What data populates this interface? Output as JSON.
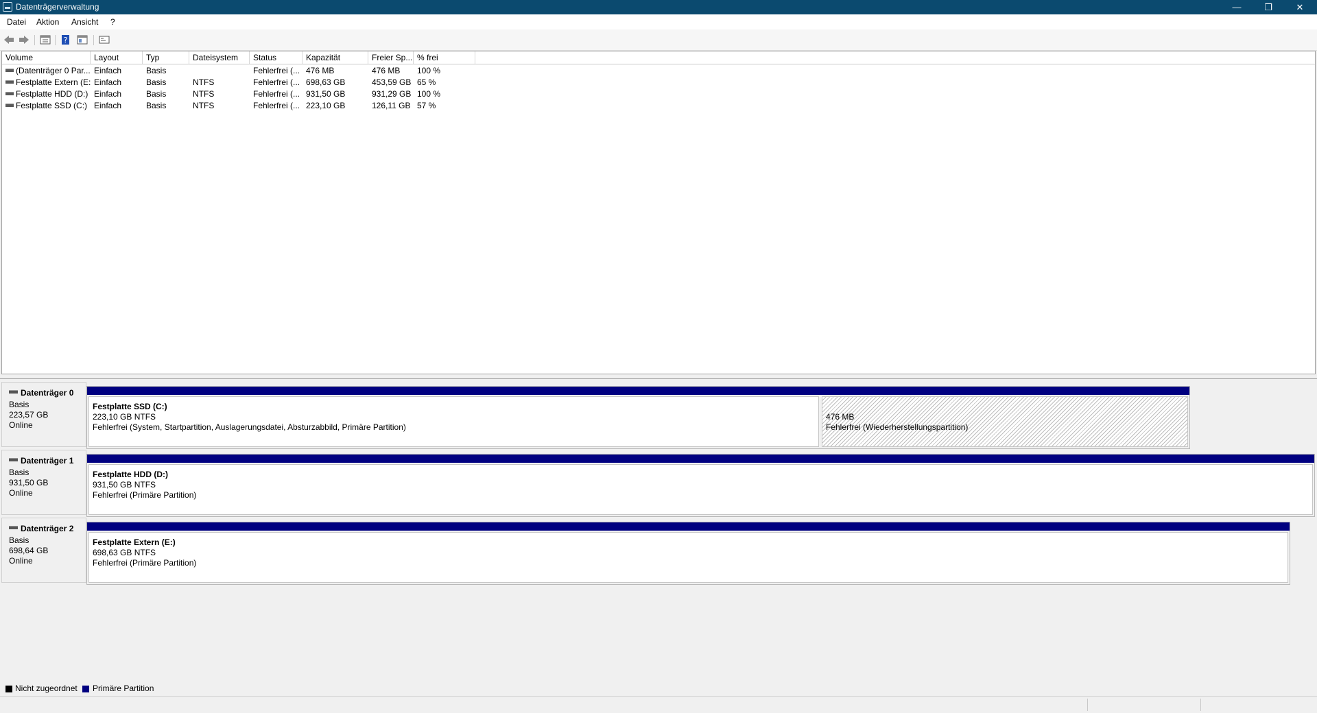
{
  "window": {
    "title": "Datenträgerverwaltung"
  },
  "menu": [
    "Datei",
    "Aktion",
    "Ansicht",
    "?"
  ],
  "volume_list": {
    "columns": [
      "Volume",
      "Layout",
      "Typ",
      "Dateisystem",
      "Status",
      "Kapazität",
      "Freier Sp...",
      "% frei"
    ],
    "rows": [
      [
        "(Datenträger 0 Par...",
        "Einfach",
        "Basis",
        "",
        "Fehlerfrei (...",
        "476 MB",
        "476 MB",
        "100 %"
      ],
      [
        "Festplatte Extern (E:)",
        "Einfach",
        "Basis",
        "NTFS",
        "Fehlerfrei (...",
        "698,63 GB",
        "453,59 GB",
        "65 %"
      ],
      [
        "Festplatte HDD (D:)",
        "Einfach",
        "Basis",
        "NTFS",
        "Fehlerfrei (...",
        "931,50 GB",
        "931,29 GB",
        "100 %"
      ],
      [
        "Festplatte SSD (C:)",
        "Einfach",
        "Basis",
        "NTFS",
        "Fehlerfrei (...",
        "223,10 GB",
        "126,11 GB",
        "57 %"
      ]
    ]
  },
  "disks": [
    {
      "name": "Datenträger 0",
      "type": "Basis",
      "size": "223,57 GB",
      "state": "Online",
      "partitions": [
        {
          "title": "Festplatte SSD  (C:)",
          "size_fs": "223,10 GB NTFS",
          "status": "Fehlerfrei (System, Startpartition, Auslagerungsdatei, Absturzabbild, Primäre Partition)"
        },
        {
          "title": "",
          "size_fs": "476 MB",
          "status": "Fehlerfrei (Wiederherstellungspartition)"
        }
      ]
    },
    {
      "name": "Datenträger 1",
      "type": "Basis",
      "size": "931,50 GB",
      "state": "Online",
      "partitions": [
        {
          "title": "Festplatte HDD  (D:)",
          "size_fs": "931,50 GB NTFS",
          "status": "Fehlerfrei (Primäre Partition)"
        }
      ]
    },
    {
      "name": "Datenträger 2",
      "type": "Basis",
      "size": "698,64 GB",
      "state": "Online",
      "partitions": [
        {
          "title": "Festplatte Extern  (E:)",
          "size_fs": "698,63 GB NTFS",
          "status": "Fehlerfrei (Primäre Partition)"
        }
      ]
    }
  ],
  "legend": [
    {
      "label": "Nicht zugeordnet",
      "color": "#000000"
    },
    {
      "label": "Primäre Partition",
      "color": "#000080"
    }
  ],
  "colors": {
    "titlebar": "#0b4a6f",
    "primary_partition": "#000080"
  },
  "icons": [
    "back-icon",
    "forward-icon",
    "list-icon",
    "help-icon",
    "properties-icon",
    "console-icon"
  ]
}
